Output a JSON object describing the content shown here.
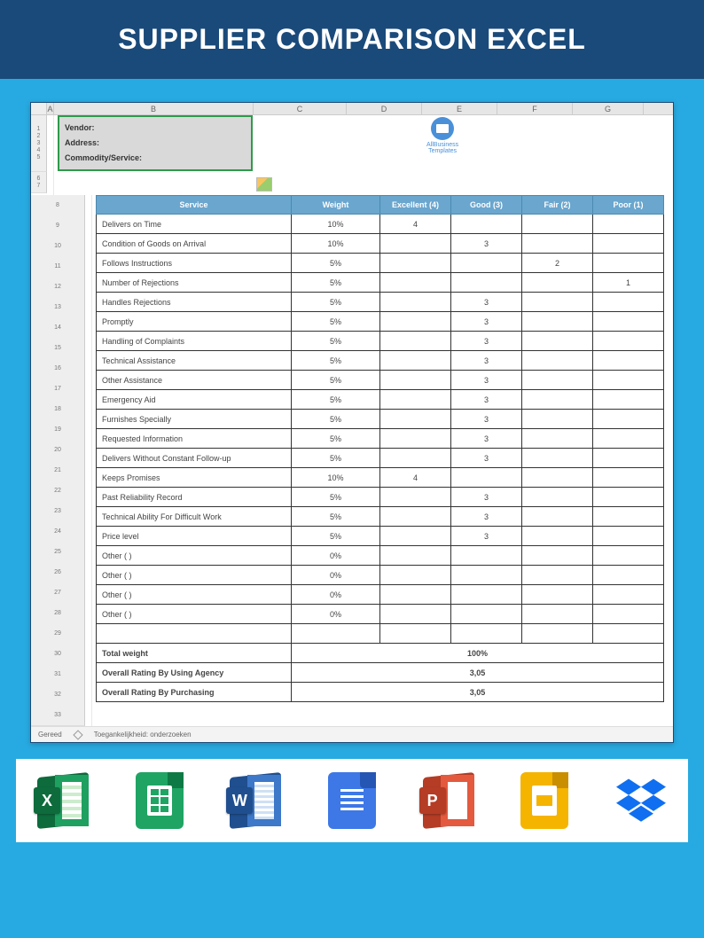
{
  "banner": {
    "title": "SUPPLIER COMPARISON EXCEL"
  },
  "columns": [
    "A",
    "B",
    "C",
    "D",
    "E",
    "F",
    "G"
  ],
  "row_numbers_top": [
    "1",
    "2",
    "3",
    "4",
    "5"
  ],
  "vendor_box": {
    "l1": "Vendor:",
    "l2": "Address:",
    "l3": "Commodity/Service:"
  },
  "logo": {
    "l1": "AllBusiness",
    "l2": "Templates"
  },
  "headers": {
    "service": "Service",
    "weight": "Weight",
    "excellent": "Excellent (4)",
    "good": "Good (3)",
    "fair": "Fair (2)",
    "poor": "Poor (1)"
  },
  "rows": [
    {
      "svc": "Delivers on Time",
      "wt": "10%",
      "ex": "4",
      "gd": "",
      "fa": "",
      "po": ""
    },
    {
      "svc": "Condition of Goods on Arrival",
      "wt": "10%",
      "ex": "",
      "gd": "3",
      "fa": "",
      "po": ""
    },
    {
      "svc": "Follows Instructions",
      "wt": "5%",
      "ex": "",
      "gd": "",
      "fa": "2",
      "po": ""
    },
    {
      "svc": "Number of Rejections",
      "wt": "5%",
      "ex": "",
      "gd": "",
      "fa": "",
      "po": "1"
    },
    {
      "svc": "Handles Rejections",
      "wt": "5%",
      "ex": "",
      "gd": "3",
      "fa": "",
      "po": ""
    },
    {
      "svc": "Promptly",
      "wt": "5%",
      "ex": "",
      "gd": "3",
      "fa": "",
      "po": ""
    },
    {
      "svc": "Handling of Complaints",
      "wt": "5%",
      "ex": "",
      "gd": "3",
      "fa": "",
      "po": ""
    },
    {
      "svc": "Technical Assistance",
      "wt": "5%",
      "ex": "",
      "gd": "3",
      "fa": "",
      "po": ""
    },
    {
      "svc": "Other Assistance",
      "wt": "5%",
      "ex": "",
      "gd": "3",
      "fa": "",
      "po": ""
    },
    {
      "svc": "Emergency Aid",
      "wt": "5%",
      "ex": "",
      "gd": "3",
      "fa": "",
      "po": ""
    },
    {
      "svc": "Furnishes Specially",
      "wt": "5%",
      "ex": "",
      "gd": "3",
      "fa": "",
      "po": ""
    },
    {
      "svc": "Requested Information",
      "wt": "5%",
      "ex": "",
      "gd": "3",
      "fa": "",
      "po": ""
    },
    {
      "svc": "Delivers Without Constant Follow-up",
      "wt": "5%",
      "ex": "",
      "gd": "3",
      "fa": "",
      "po": ""
    },
    {
      "svc": "Keeps Promises",
      "wt": "10%",
      "ex": "4",
      "gd": "",
      "fa": "",
      "po": ""
    },
    {
      "svc": "Past Reliability Record",
      "wt": "5%",
      "ex": "",
      "gd": "3",
      "fa": "",
      "po": ""
    },
    {
      "svc": "Technical Ability For Difficult Work",
      "wt": "5%",
      "ex": "",
      "gd": "3",
      "fa": "",
      "po": ""
    },
    {
      "svc": "Price level",
      "wt": "5%",
      "ex": "",
      "gd": "3",
      "fa": "",
      "po": ""
    },
    {
      "svc": "Other ( )",
      "wt": "0%",
      "ex": "",
      "gd": "",
      "fa": "",
      "po": ""
    },
    {
      "svc": "Other ( )",
      "wt": "0%",
      "ex": "",
      "gd": "",
      "fa": "",
      "po": ""
    },
    {
      "svc": "Other ( )",
      "wt": "0%",
      "ex": "",
      "gd": "",
      "fa": "",
      "po": ""
    },
    {
      "svc": "Other ( )",
      "wt": "0%",
      "ex": "",
      "gd": "",
      "fa": "",
      "po": ""
    }
  ],
  "totals": {
    "total_weight_label": "Total weight",
    "total_weight_value": "100%",
    "rating_agency_label": "Overall Rating By Using Agency",
    "rating_agency_value": "3,05",
    "rating_purchasing_label": "Overall Rating By Purchasing",
    "rating_purchasing_value": "3,05"
  },
  "statusbar": {
    "ready": "Gereed",
    "access": "Toegankelijkheid: onderzoeken"
  },
  "apps": {
    "excel": "X",
    "sheets": "",
    "word": "W",
    "docs": "",
    "ppt": "P",
    "slides": "",
    "dropbox": ""
  },
  "chart_data": {
    "type": "table",
    "title": "Supplier Comparison",
    "columns": [
      "Service",
      "Weight",
      "Excellent (4)",
      "Good (3)",
      "Fair (2)",
      "Poor (1)"
    ],
    "data": [
      [
        "Delivers on Time",
        "10%",
        4,
        null,
        null,
        null
      ],
      [
        "Condition of Goods on Arrival",
        "10%",
        null,
        3,
        null,
        null
      ],
      [
        "Follows Instructions",
        "5%",
        null,
        null,
        2,
        null
      ],
      [
        "Number of Rejections",
        "5%",
        null,
        null,
        null,
        1
      ],
      [
        "Handles Rejections",
        "5%",
        null,
        3,
        null,
        null
      ],
      [
        "Promptly",
        "5%",
        null,
        3,
        null,
        null
      ],
      [
        "Handling of Complaints",
        "5%",
        null,
        3,
        null,
        null
      ],
      [
        "Technical Assistance",
        "5%",
        null,
        3,
        null,
        null
      ],
      [
        "Other Assistance",
        "5%",
        null,
        3,
        null,
        null
      ],
      [
        "Emergency Aid",
        "5%",
        null,
        3,
        null,
        null
      ],
      [
        "Furnishes Specially",
        "5%",
        null,
        3,
        null,
        null
      ],
      [
        "Requested Information",
        "5%",
        null,
        3,
        null,
        null
      ],
      [
        "Delivers Without Constant Follow-up",
        "5%",
        null,
        3,
        null,
        null
      ],
      [
        "Keeps Promises",
        "10%",
        4,
        null,
        null,
        null
      ],
      [
        "Past Reliability Record",
        "5%",
        null,
        3,
        null,
        null
      ],
      [
        "Technical Ability For Difficult Work",
        "5%",
        null,
        3,
        null,
        null
      ],
      [
        "Price level",
        "5%",
        null,
        3,
        null,
        null
      ],
      [
        "Other ( )",
        "0%",
        null,
        null,
        null,
        null
      ],
      [
        "Other ( )",
        "0%",
        null,
        null,
        null,
        null
      ],
      [
        "Other ( )",
        "0%",
        null,
        null,
        null,
        null
      ],
      [
        "Other ( )",
        "0%",
        null,
        null,
        null,
        null
      ]
    ],
    "summary": {
      "Total weight": "100%",
      "Overall Rating By Using Agency": "3,05",
      "Overall Rating By Purchasing": "3,05"
    }
  }
}
